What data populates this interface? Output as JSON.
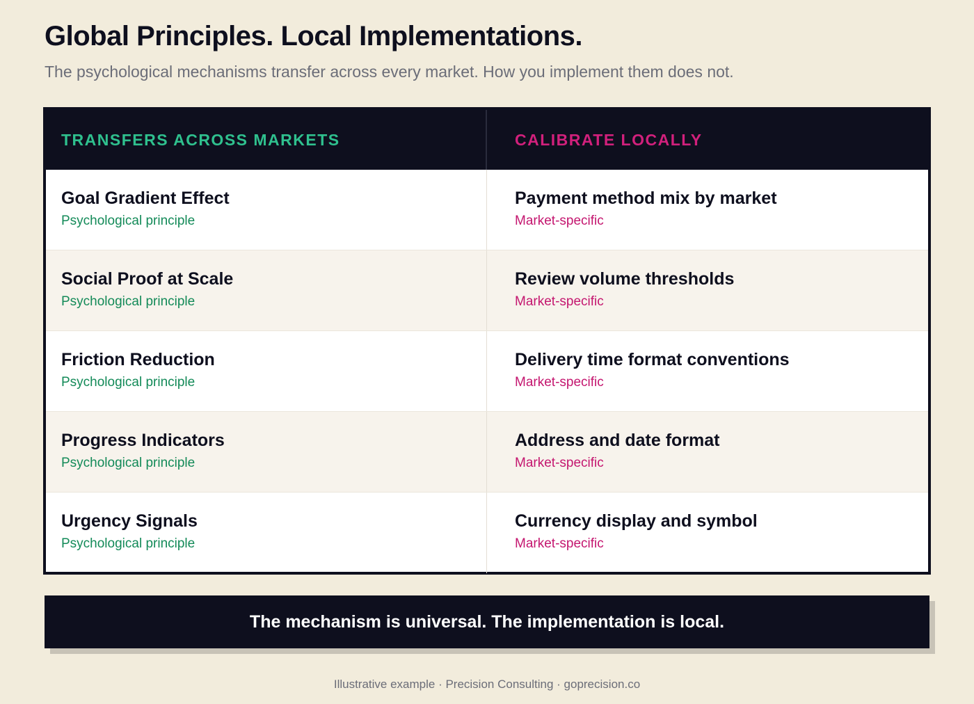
{
  "header": {
    "title": "Global Principles. Local Implementations.",
    "subtitle": "The psychological mechanisms transfer across every market. How you implement them does not."
  },
  "table": {
    "left_heading": "TRANSFERS ACROSS MARKETS",
    "right_heading": "CALIBRATE LOCALLY",
    "rows": [
      {
        "left": {
          "title": "Goal Gradient Effect",
          "sub": "Psychological principle"
        },
        "right": {
          "title": "Payment method mix by market",
          "sub": "Market-specific"
        }
      },
      {
        "left": {
          "title": "Social Proof at Scale",
          "sub": "Psychological principle"
        },
        "right": {
          "title": "Review volume thresholds",
          "sub": "Market-specific"
        }
      },
      {
        "left": {
          "title": "Friction Reduction",
          "sub": "Psychological principle"
        },
        "right": {
          "title": "Delivery time format conventions",
          "sub": "Market-specific"
        }
      },
      {
        "left": {
          "title": "Progress Indicators",
          "sub": "Psychological principle"
        },
        "right": {
          "title": "Address and date format",
          "sub": "Market-specific"
        }
      },
      {
        "left": {
          "title": "Urgency Signals",
          "sub": "Psychological principle"
        },
        "right": {
          "title": "Currency display and symbol",
          "sub": "Market-specific"
        }
      }
    ]
  },
  "banner": {
    "text": "The mechanism is universal. The implementation is local."
  },
  "footer": {
    "text": "Illustrative example · Precision Consulting · goprecision.co"
  },
  "colors": {
    "background": "#f2ecdc",
    "dark": "#0e0f1e",
    "green_heading": "#2fc08e",
    "green_text": "#138a58",
    "magenta_heading": "#d1207c",
    "magenta_text": "#c4166f",
    "muted_text": "#6b6d78"
  }
}
